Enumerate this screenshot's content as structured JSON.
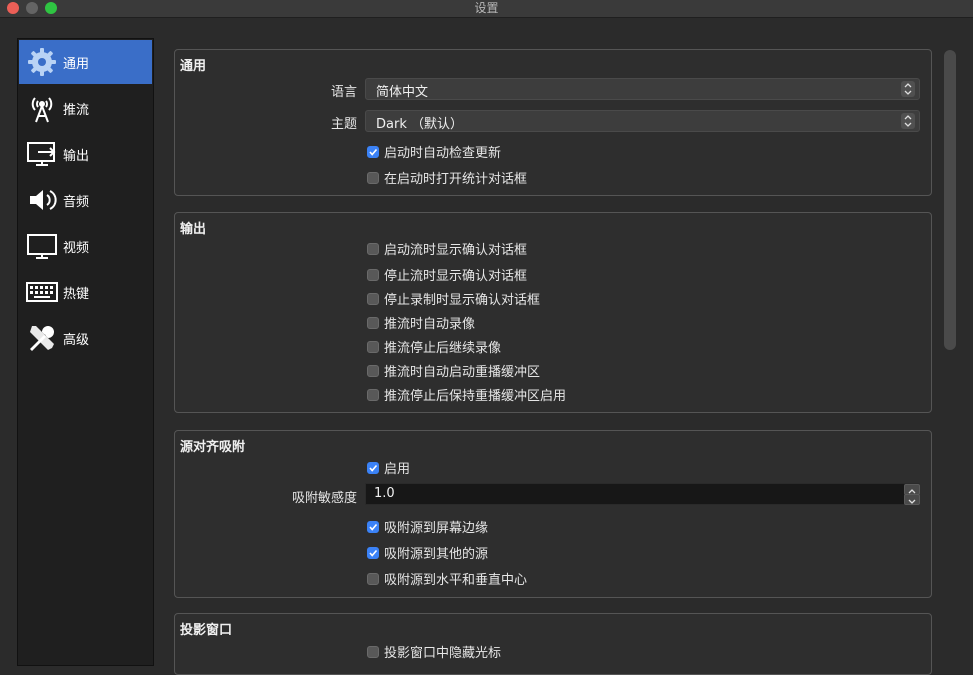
{
  "window": {
    "title": "设置"
  },
  "sidebar": {
    "items": [
      {
        "label": "通用",
        "icon": "gear-icon",
        "active": true
      },
      {
        "label": "推流",
        "icon": "broadcast-antenna-icon",
        "active": false
      },
      {
        "label": "输出",
        "icon": "monitor-output-icon",
        "active": false
      },
      {
        "label": "音频",
        "icon": "speaker-icon",
        "active": false
      },
      {
        "label": "视频",
        "icon": "monitor-icon",
        "active": false
      },
      {
        "label": "热键",
        "icon": "keyboard-icon",
        "active": false
      },
      {
        "label": "高级",
        "icon": "wrench-screwdriver-icon",
        "active": false
      }
    ]
  },
  "general": {
    "title": "通用",
    "language_label": "语言",
    "language_value": "简体中文",
    "theme_label": "主题",
    "theme_value": "Dark （默认）",
    "checks": [
      {
        "label": "启动时自动检查更新",
        "checked": true
      },
      {
        "label": "在启动时打开统计对话框",
        "checked": false
      }
    ]
  },
  "output": {
    "title": "输出",
    "checks": [
      {
        "label": "启动流时显示确认对话框",
        "checked": false
      },
      {
        "label": "停止流时显示确认对话框",
        "checked": false
      },
      {
        "label": "停止录制时显示确认对话框",
        "checked": false
      },
      {
        "label": "推流时自动录像",
        "checked": false
      },
      {
        "label": "推流停止后继续录像",
        "checked": false
      },
      {
        "label": "推流时自动启动重播缓冲区",
        "checked": false
      },
      {
        "label": "推流停止后保持重播缓冲区启用",
        "checked": false
      }
    ]
  },
  "snapping": {
    "title": "源对齐吸附",
    "enable": {
      "label": "启用",
      "checked": true
    },
    "sensitivity_label": "吸附敏感度",
    "sensitivity_value": "1.0",
    "checks": [
      {
        "label": "吸附源到屏幕边缘",
        "checked": true
      },
      {
        "label": "吸附源到其他的源",
        "checked": true
      },
      {
        "label": "吸附源到水平和垂直中心",
        "checked": false
      }
    ]
  },
  "projector": {
    "title": "投影窗口",
    "checks": [
      {
        "label": "投影窗口中隐藏光标",
        "checked": false
      }
    ]
  },
  "colors": {
    "accent": "#3b82f6",
    "sidebar_active": "#3a6ec8"
  }
}
